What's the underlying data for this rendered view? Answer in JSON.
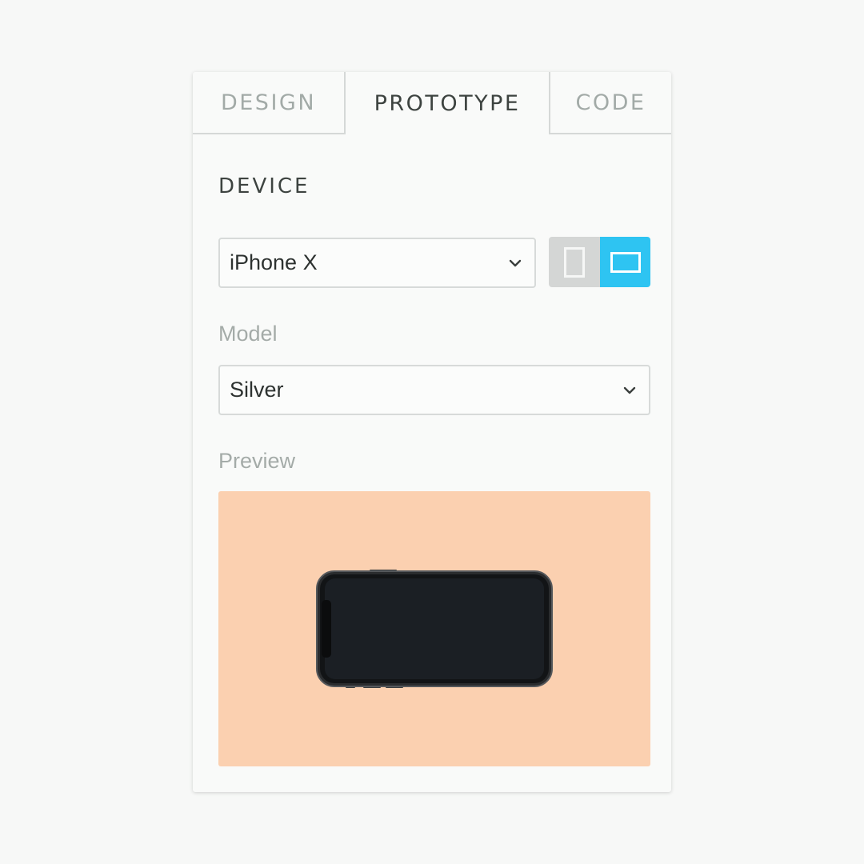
{
  "tabs": [
    {
      "label": "DESIGN",
      "active": false
    },
    {
      "label": "PROTOTYPE",
      "active": true
    },
    {
      "label": "CODE",
      "active": false
    }
  ],
  "device_section": {
    "title": "DEVICE",
    "device_select": {
      "value": "iPhone X",
      "icon": "chevron-down-icon"
    },
    "orientation": {
      "options": [
        "portrait",
        "landscape"
      ],
      "selected": "landscape",
      "accent_color": "#2ec4f2",
      "inactive_color": "#d4d6d5"
    }
  },
  "model": {
    "label": "Model",
    "select": {
      "value": "Silver",
      "icon": "chevron-down-icon"
    }
  },
  "preview": {
    "label": "Preview",
    "background_color": "#fbd0b0",
    "device_image": "iphone-x-landscape",
    "screen_color": "#1b1f24"
  }
}
